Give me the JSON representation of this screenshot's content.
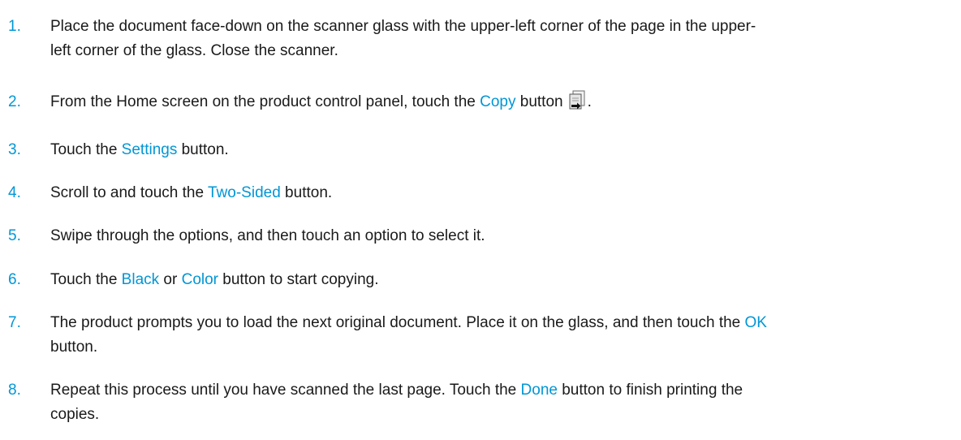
{
  "accent_color": "#0096d6",
  "steps": [
    {
      "number": "1.",
      "line1": "Place the document face-down on the scanner glass with the upper-left corner of the page in the upper-",
      "line2": "left corner of the glass. Close the scanner."
    },
    {
      "number": "2.",
      "before": "From the Home screen on the product control panel, touch the ",
      "ui": "Copy",
      "after": " button",
      "icon": "copy-icon",
      "end": "."
    },
    {
      "number": "3.",
      "before": "Touch the ",
      "ui": "Settings",
      "after": " button."
    },
    {
      "number": "4.",
      "before": "Scroll to and touch the ",
      "ui": "Two-Sided",
      "after": " button."
    },
    {
      "number": "5.",
      "text": "Swipe through the options, and then touch an option to select it."
    },
    {
      "number": "6.",
      "before": "Touch the ",
      "ui": "Black",
      "middle": " or ",
      "ui2": "Color",
      "after": " button to start copying."
    },
    {
      "number": "7.",
      "before": "The product prompts you to load the next original document. Place it on the glass, and then touch the ",
      "ui": "OK",
      "line2": "button."
    },
    {
      "number": "8.",
      "before": "Repeat this process until you have scanned the last page. Touch the ",
      "ui": "Done",
      "after": " button to finish printing the",
      "line2": "copies."
    }
  ]
}
